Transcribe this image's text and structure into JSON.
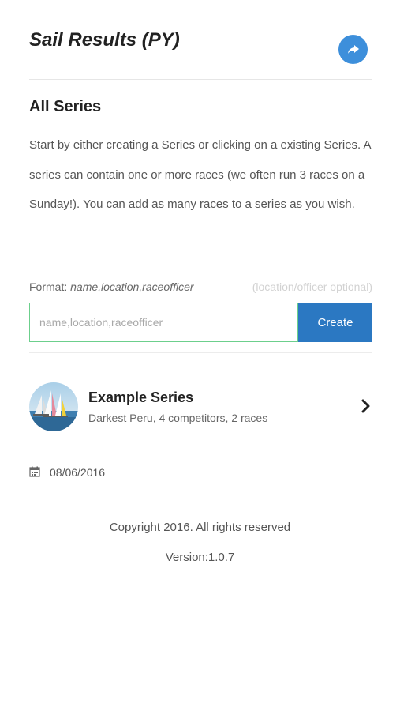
{
  "header": {
    "title": "Sail Results (PY)",
    "share_icon": "share-icon",
    "share_color": "#3d8fdb"
  },
  "section": {
    "title": "All Series",
    "intro": "Start by either creating a Series or clicking on a existing Series. A series can contain one or more races (we often run 3 races on a Sunday!). You can add as many races to a series as you wish."
  },
  "create_form": {
    "format_label": "Format:",
    "format_example": "name,location,raceofficer",
    "format_hint": "(location/officer optional)",
    "input_placeholder": "name,location,raceofficer",
    "input_value": "",
    "create_label": "Create",
    "button_color": "#2b78c2",
    "input_border_color": "#6ccf8c"
  },
  "series_list": [
    {
      "name": "Example Series",
      "meta": "Darkest Peru, 4 competitors, 2 races",
      "avatar_icon": "sailboats-image",
      "chevron_icon": "chevron-right-icon"
    }
  ],
  "date": {
    "icon": "calendar-icon",
    "value": "08/06/2016"
  },
  "footer": {
    "copyright": "Copyright 2016. All rights reserved",
    "version": "Version:1.0.7"
  }
}
